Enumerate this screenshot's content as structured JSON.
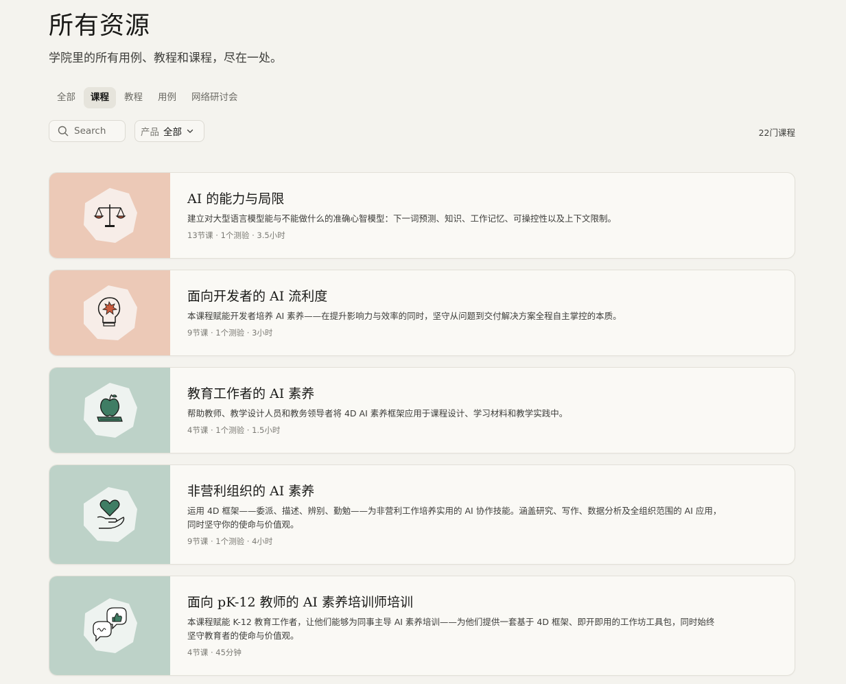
{
  "page": {
    "title": "所有资源",
    "subtitle": "学院里的所有用例、教程和课程，尽在一处。"
  },
  "tabs": [
    {
      "label": "全部",
      "active": false
    },
    {
      "label": "课程",
      "active": true
    },
    {
      "label": "教程",
      "active": false
    },
    {
      "label": "用例",
      "active": false
    },
    {
      "label": "网络研讨会",
      "active": false
    }
  ],
  "search": {
    "placeholder": "Search",
    "value": "",
    "icon": "search-icon"
  },
  "product_filter": {
    "label": "产品",
    "value": "全部",
    "icon": "chevron-down-icon"
  },
  "result_count": "22门课程",
  "colors": {
    "background": "#f4f3ee",
    "card_background": "#faf9f5",
    "thumb_peach": "#ecc9b7",
    "thumb_sage": "#bdd2c8",
    "accent_red": "#c95b3e",
    "accent_green": "#3f7d64"
  },
  "courses": [
    {
      "title": "AI 的能力与局限",
      "description": "建立对大型语言模型能与不能做什么的准确心智模型：下一词预测、知识、工作记忆、可操控性以及上下文限制。",
      "meta": "13节课 · 1个测验 · 3.5小时",
      "icon": "scales-icon",
      "theme": "peach"
    },
    {
      "title": "面向开发者的 AI 流利度",
      "description": "本课程赋能开发者培养 AI 素养——在提升影响力与效率的同时，坚守从问题到交付解决方案全程自主掌控的本质。",
      "meta": "9节课 · 1个测验 · 3小时",
      "icon": "head-burst-icon",
      "theme": "peach"
    },
    {
      "title": "教育工作者的 AI 素养",
      "description": "帮助教师、教学设计人员和教务领导者将 4D AI 素养框架应用于课程设计、学习材料和教学实践中。",
      "meta": "4节课 · 1个测验 · 1.5小时",
      "icon": "apple-book-icon",
      "theme": "sage"
    },
    {
      "title": "非营利组织的 AI 素养",
      "description": "运用 4D 框架——委派、描述、辨别、勤勉——为非营利工作培养实用的 AI 协作技能。涵盖研究、写作、数据分析及全组织范围的 AI 应用，同时坚守你的使命与价值观。",
      "meta": "9节课 · 1个测验 · 4小时",
      "icon": "heart-hand-icon",
      "theme": "sage"
    },
    {
      "title": "面向 pK-12 教师的 AI 素养培训师培训",
      "description": "本课程赋能 K-12 教育工作者，让他们能够为同事主导 AI 素养培训——为他们提供一套基于 4D 框架、即开即用的工作坊工具包，同时始终坚守教育者的使命与价值观。",
      "meta": "4节课 · 45分钟",
      "icon": "chat-bubbles-icon",
      "theme": "sage"
    }
  ]
}
